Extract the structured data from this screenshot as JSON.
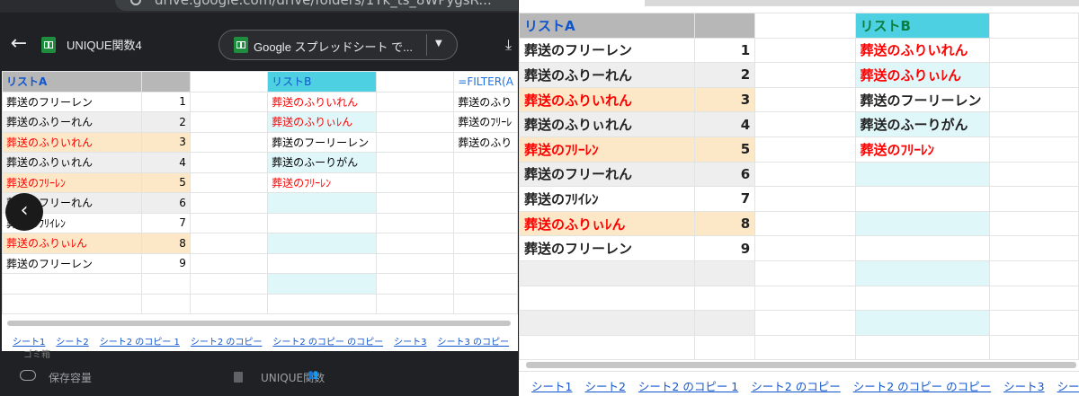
{
  "browser": {
    "url_text": "drive.google.com/drive/folders/1Yk_ts_8WPygsR..."
  },
  "drive": {
    "file_title": "UNIQUE関数4",
    "open_with_label": "Google スプレッドシート で...",
    "list_items": [
      {
        "label": "保存容量"
      },
      {
        "label": "UNIQUE関数"
      }
    ]
  },
  "colors": {
    "header_a": "#b7b7b7",
    "header_b": "#4dd0e1",
    "highlight_row": "#fce8c6",
    "alt_row": "#eeeeee",
    "red_text": "#ff0000"
  },
  "sheet": {
    "list_a_header": "リストA",
    "list_b_header": "リストB",
    "formula_header": "=FILTER(A",
    "list_a": [
      {
        "text": "葬送のフリーレン",
        "num": "1",
        "red": false,
        "hl": false
      },
      {
        "text": "葬送のふりーれん",
        "num": "2",
        "red": false,
        "hl": false
      },
      {
        "text": "葬送のふりいれん",
        "num": "3",
        "red": true,
        "hl": true
      },
      {
        "text": "葬送のふりぃれん",
        "num": "4",
        "red": false,
        "hl": false
      },
      {
        "text": "葬送のﾌﾘｰﾚﾝ",
        "num": "5",
        "red": true,
        "hl": true
      },
      {
        "text": "葬送のフリーれん",
        "num": "6",
        "red": false,
        "hl": false
      },
      {
        "text": "葬送のﾌﾘｲﾚﾝ",
        "num": "7",
        "red": false,
        "hl": false
      },
      {
        "text": "葬送のふりぃﾚん",
        "num": "8",
        "red": true,
        "hl": true
      },
      {
        "text": "葬送のフリーレン",
        "num": "9",
        "red": false,
        "hl": false
      }
    ],
    "list_b": [
      {
        "text": "葬送のふりいれん",
        "red": true
      },
      {
        "text": "葬送のふりぃﾚん",
        "red": true
      },
      {
        "text": "葬送のフーリーレン",
        "red": false
      },
      {
        "text": "葬送のふーりがん",
        "red": false
      },
      {
        "text": "葬送のﾌﾘｰﾚﾝ",
        "red": true
      }
    ],
    "filter_results": [
      "葬送のふり",
      "葬送のﾌﾘｰﾚ",
      "葬送のふり"
    ],
    "tabs": [
      "シート1",
      "シート2",
      "シート2 のコピー 1",
      "シート2 のコピー",
      "シート2 のコピー のコピー",
      "シート3",
      "シート3 のコピー"
    ],
    "tabs_right": [
      "シート1",
      "シート2",
      "シート2 のコピー 1",
      "シート2 のコピー",
      "シート2 のコピー のコピー",
      "シート3",
      "シー"
    ]
  }
}
